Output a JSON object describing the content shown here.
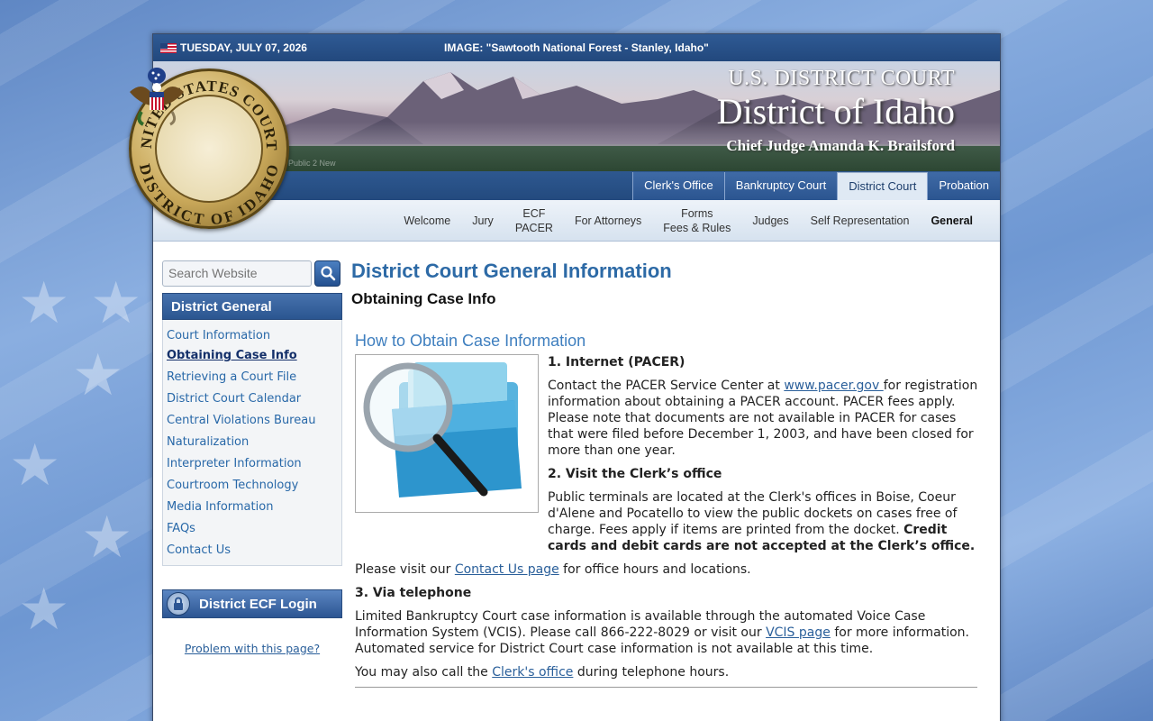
{
  "topbar": {
    "date": "TUESDAY, JULY 07, 2026",
    "image_caption": "IMAGE: \"Sawtooth National Forest - Stanley, Idaho\""
  },
  "banner": {
    "subtitle": "U.S. DISTRICT COURT",
    "title": "District of Idaho",
    "judge": "Chief Judge Amanda K. Brailsford",
    "public_note": "Public 2 New"
  },
  "seal": {
    "top_text": "UNITED STATES COURTS",
    "bottom_text": "DISTRICT OF IDAHO"
  },
  "tabs": [
    {
      "label": "Clerk's Office",
      "active": false
    },
    {
      "label": "Bankruptcy Court",
      "active": false
    },
    {
      "label": "District Court",
      "active": true
    },
    {
      "label": "Probation",
      "active": false
    }
  ],
  "subnav": [
    {
      "line1": "Welcome",
      "line2": ""
    },
    {
      "line1": "Jury",
      "line2": ""
    },
    {
      "line1": "ECF",
      "line2": "PACER"
    },
    {
      "line1": "For Attorneys",
      "line2": ""
    },
    {
      "line1": "Forms",
      "line2": "Fees & Rules"
    },
    {
      "line1": "Judges",
      "line2": ""
    },
    {
      "line1": "Self Representation",
      "line2": ""
    },
    {
      "line1": "General",
      "line2": ""
    }
  ],
  "search": {
    "placeholder": "Search Website"
  },
  "sidebar": {
    "heading": "District General",
    "items": [
      {
        "label": "Court Information"
      },
      {
        "label": "Obtaining Case Info"
      },
      {
        "label": "Retrieving a Court File"
      },
      {
        "label": "District Court Calendar"
      },
      {
        "label": "Central Violations Bureau"
      },
      {
        "label": "Naturalization"
      },
      {
        "label": "Interpreter Information"
      },
      {
        "label": "Courtroom Technology"
      },
      {
        "label": "Media Information"
      },
      {
        "label": "FAQs"
      },
      {
        "label": "Contact Us"
      }
    ],
    "ecf_login": "District ECF Login",
    "problem_link": "Problem with this page?"
  },
  "main": {
    "title": "District Court General Information",
    "subtitle": "Obtaining Case Info",
    "section_title": "How to Obtain Case Information",
    "internet_head": "1.  Internet (PACER)",
    "internet_p1": "Contact the PACER Service Center at ",
    "internet_link": "www.pacer.gov ",
    "internet_p2": "for registration information about obtaining a PACER account. PACER fees apply. Please note that documents are not available in PACER for cases that were filed before December 1, 2003, and have been closed for more than one year.",
    "clerk_head": "2.  Visit the Clerk’s office",
    "clerk_p1": "Public terminals are located at the Clerk's offices in Boise, Coeur d'Alene and Pocatello to view the public dockets on cases free of charge. Fees apply if items are printed from the docket.  ",
    "clerk_bold": "Credit cards and debit cards are not accepted at the Clerk’s office.",
    "visit_p1": "Please visit our ",
    "visit_link": "Contact Us page",
    "visit_p2": " for office hours and locations.",
    "phone_head": "3. Via telephone",
    "phone_p1": "Limited Bankruptcy Court case information is available through the automated Voice Case Information System (VCIS). Please call 866-222-8029 or visit our ",
    "phone_link": "VCIS page",
    "phone_p2": " for more information. Automated service for District Court case information is not available at this time.",
    "also_p1": "You may also call the ",
    "also_link": "Clerk's office",
    "also_p2": " during telephone hours."
  }
}
